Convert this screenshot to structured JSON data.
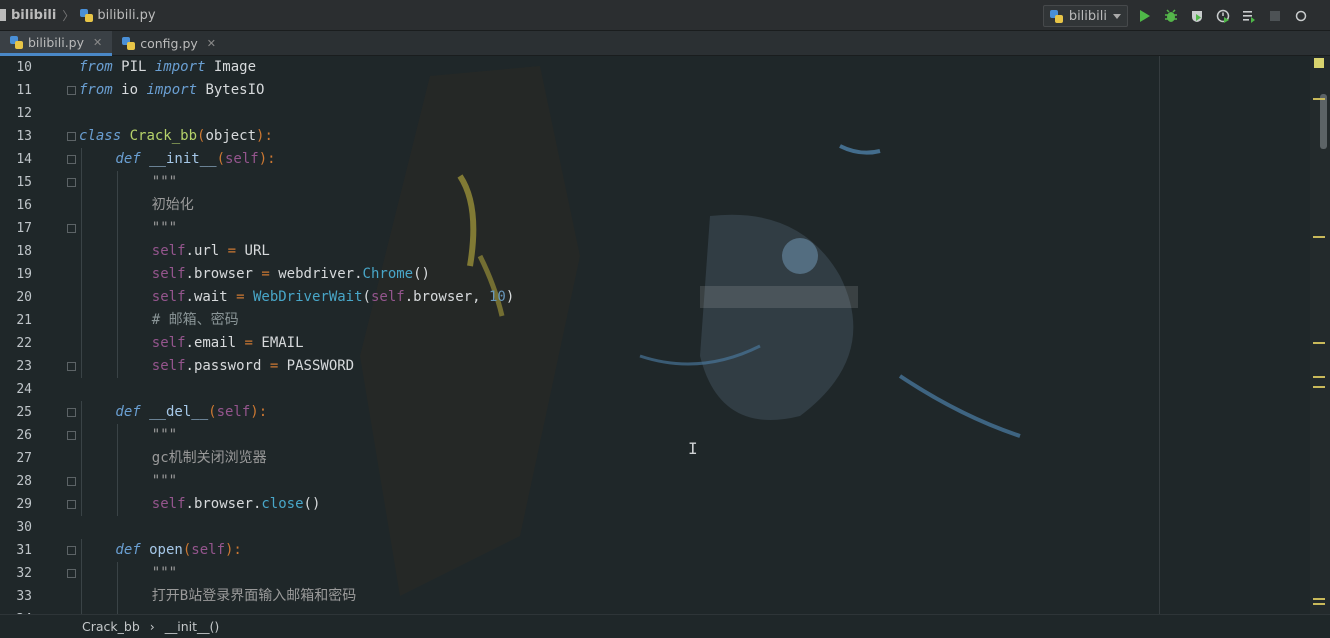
{
  "navbar": {
    "project": "bilibili",
    "file": "bilibili.py",
    "run_config": "bilibili"
  },
  "tabs": [
    {
      "label": "bilibili.py",
      "active": true
    },
    {
      "label": "config.py",
      "active": false
    }
  ],
  "editor": {
    "lines": [
      {
        "no": "10",
        "indent": 0,
        "fold": false,
        "tokens": [
          [
            "kw",
            "from"
          ],
          [
            "plain",
            " PIL "
          ],
          [
            "kw",
            "import"
          ],
          [
            "plain",
            " Image"
          ]
        ]
      },
      {
        "no": "11",
        "indent": 0,
        "fold": true,
        "tokens": [
          [
            "kw",
            "from"
          ],
          [
            "plain",
            " io "
          ],
          [
            "kw",
            "import"
          ],
          [
            "plain",
            " BytesIO"
          ]
        ]
      },
      {
        "no": "12",
        "indent": 0,
        "fold": false,
        "tokens": []
      },
      {
        "no": "13",
        "indent": 0,
        "fold": true,
        "tokens": [
          [
            "kw",
            "class"
          ],
          [
            "plain",
            " "
          ],
          [
            "cls",
            "Crack_bb"
          ],
          [
            "op",
            "("
          ],
          [
            "plain",
            "object"
          ],
          [
            "op",
            "):"
          ]
        ]
      },
      {
        "no": "14",
        "indent": 1,
        "fold": true,
        "tokens": [
          [
            "kw",
            "def"
          ],
          [
            "plain",
            " "
          ],
          [
            "fn",
            "__init__"
          ],
          [
            "op",
            "("
          ],
          [
            "slf",
            "self"
          ],
          [
            "op",
            "):"
          ]
        ]
      },
      {
        "no": "15",
        "indent": 2,
        "fold": true,
        "tokens": [
          [
            "str",
            "\"\"\""
          ]
        ]
      },
      {
        "no": "16",
        "indent": 2,
        "fold": false,
        "tokens": [
          [
            "str",
            "初始化"
          ]
        ]
      },
      {
        "no": "17",
        "indent": 2,
        "fold": true,
        "tokens": [
          [
            "str",
            "\"\"\""
          ]
        ]
      },
      {
        "no": "18",
        "indent": 2,
        "fold": false,
        "tokens": [
          [
            "slf",
            "self"
          ],
          [
            "plain",
            ".url "
          ],
          [
            "op",
            "="
          ],
          [
            "plain",
            " URL"
          ]
        ]
      },
      {
        "no": "19",
        "indent": 2,
        "fold": false,
        "tokens": [
          [
            "slf",
            "self"
          ],
          [
            "plain",
            ".browser "
          ],
          [
            "op",
            "="
          ],
          [
            "plain",
            " webdriver."
          ],
          [
            "call",
            "Chrome"
          ],
          [
            "plain",
            "()"
          ]
        ]
      },
      {
        "no": "20",
        "indent": 2,
        "fold": false,
        "tokens": [
          [
            "slf",
            "self"
          ],
          [
            "plain",
            ".wait "
          ],
          [
            "op",
            "="
          ],
          [
            "plain",
            " "
          ],
          [
            "call",
            "WebDriverWait"
          ],
          [
            "plain",
            "("
          ],
          [
            "slf",
            "self"
          ],
          [
            "plain",
            ".browser, "
          ],
          [
            "num",
            "10"
          ],
          [
            "plain",
            ")"
          ]
        ]
      },
      {
        "no": "21",
        "indent": 2,
        "fold": false,
        "tokens": [
          [
            "cmt",
            "# 邮箱、密码"
          ]
        ]
      },
      {
        "no": "22",
        "indent": 2,
        "fold": false,
        "tokens": [
          [
            "slf",
            "self"
          ],
          [
            "plain",
            ".email "
          ],
          [
            "op",
            "="
          ],
          [
            "plain",
            " EMAIL"
          ]
        ]
      },
      {
        "no": "23",
        "indent": 2,
        "fold": true,
        "tokens": [
          [
            "slf",
            "self"
          ],
          [
            "plain",
            ".password "
          ],
          [
            "op",
            "="
          ],
          [
            "plain",
            " PASSWORD"
          ]
        ]
      },
      {
        "no": "24",
        "indent": 0,
        "fold": false,
        "tokens": []
      },
      {
        "no": "25",
        "indent": 1,
        "fold": true,
        "tokens": [
          [
            "kw",
            "def"
          ],
          [
            "plain",
            " "
          ],
          [
            "fn",
            "__del__"
          ],
          [
            "op",
            "("
          ],
          [
            "slf",
            "self"
          ],
          [
            "op",
            "):"
          ]
        ]
      },
      {
        "no": "26",
        "indent": 2,
        "fold": true,
        "tokens": [
          [
            "str",
            "\"\"\""
          ]
        ]
      },
      {
        "no": "27",
        "indent": 2,
        "fold": false,
        "tokens": [
          [
            "str",
            "gc机制关闭浏览器"
          ]
        ]
      },
      {
        "no": "28",
        "indent": 2,
        "fold": true,
        "tokens": [
          [
            "str",
            "\"\"\""
          ]
        ]
      },
      {
        "no": "29",
        "indent": 2,
        "fold": true,
        "tokens": [
          [
            "slf",
            "self"
          ],
          [
            "plain",
            ".browser."
          ],
          [
            "call",
            "close"
          ],
          [
            "plain",
            "()"
          ]
        ]
      },
      {
        "no": "30",
        "indent": 0,
        "fold": false,
        "tokens": []
      },
      {
        "no": "31",
        "indent": 1,
        "fold": true,
        "tokens": [
          [
            "kw",
            "def"
          ],
          [
            "plain",
            " "
          ],
          [
            "fn",
            "open"
          ],
          [
            "op",
            "("
          ],
          [
            "slf",
            "self"
          ],
          [
            "op",
            "):"
          ]
        ]
      },
      {
        "no": "32",
        "indent": 2,
        "fold": true,
        "tokens": [
          [
            "str",
            "\"\"\""
          ]
        ]
      },
      {
        "no": "33",
        "indent": 2,
        "fold": false,
        "tokens": [
          [
            "str",
            "打开B站登录界面输入邮箱和密码"
          ]
        ]
      },
      {
        "no": "34",
        "indent": 2,
        "fold": false,
        "tokens": []
      }
    ]
  },
  "breadcrumb": {
    "items": [
      "Crack_bb",
      "__init__()"
    ],
    "separator": "›"
  },
  "colors": {
    "keyword": "#6a9fd2",
    "class": "#b6d36a",
    "self": "#94558d",
    "string": "#9a9a9a",
    "number": "#6897bb",
    "run": "#4fb748",
    "debug": "#55b64a",
    "active_tab_underline": "#4a88c7"
  },
  "icons": [
    "python-file-icon",
    "run-icon",
    "debug-icon",
    "coverage-icon",
    "profile-icon",
    "run-list-icon",
    "stop-icon",
    "search-icon"
  ]
}
